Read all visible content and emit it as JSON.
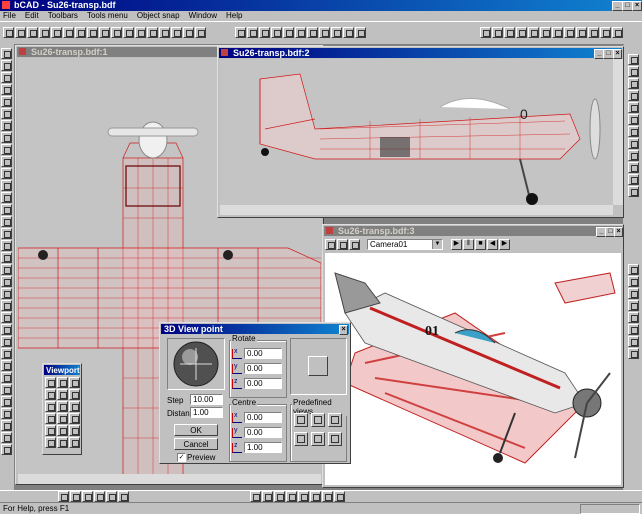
{
  "app": {
    "title": "bCAD - Su26-transp.bdf",
    "title_controls": [
      "_",
      "□",
      "×"
    ]
  },
  "menu": [
    "File",
    "Edit",
    "Toolbars",
    "Tools menu",
    "Object snap",
    "Window",
    "Help"
  ],
  "windows": {
    "top": {
      "title": "Su26-transp.bdf:1"
    },
    "side": {
      "title": "Su26-transp.bdf:2"
    },
    "render": {
      "title": "Su26-transp.bdf:3",
      "camera": "Camera01"
    }
  },
  "viewport_palette": {
    "title": "Viewport"
  },
  "dialog": {
    "title": "3D View point",
    "step_label": "Step",
    "step_value": "10.00",
    "distance_label": "Distance",
    "distance_value": "1.00",
    "ok_label": "OK",
    "cancel_label": "Cancel",
    "preview_label": "Preview",
    "preview_checked": true,
    "rotate_label": "Rotate",
    "rotate_values": [
      "0.00",
      "0.00",
      "0.00"
    ],
    "centre_label": "Centre",
    "centre_values": [
      "0.00",
      "0.00",
      "1.00"
    ],
    "predefined_label": "Predefined views",
    "axis_labels": [
      "x",
      "y",
      "z"
    ]
  },
  "status": {
    "text": "For Help, press F1"
  },
  "colors": {
    "titlebar": "#000080",
    "wire": "#d01818",
    "desktop": "#c0c0c0"
  }
}
